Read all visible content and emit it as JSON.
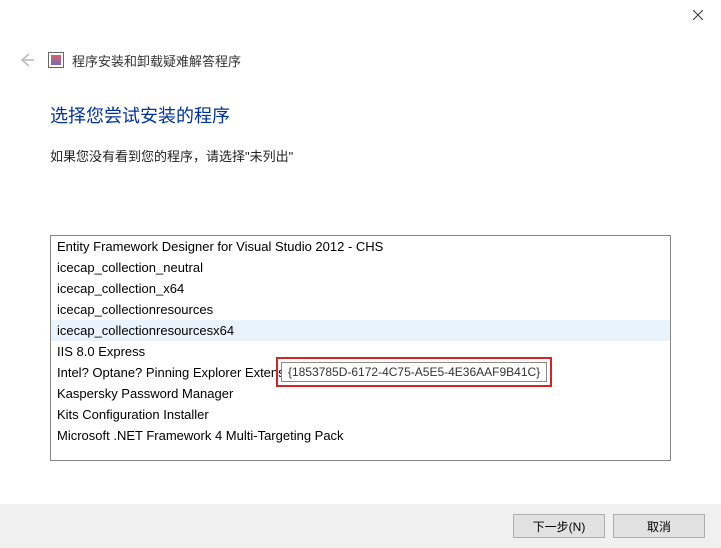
{
  "titlebar": {
    "close_label": "Close"
  },
  "header": {
    "back_label": "Back",
    "title": "程序安装和卸载疑难解答程序"
  },
  "content": {
    "heading": "选择您尝试安装的程序",
    "instruction": "如果您没有看到您的程序，请选择\"未列出\""
  },
  "programs": [
    "Entity Framework Designer for Visual Studio 2012 - CHS",
    "icecap_collection_neutral",
    "icecap_collection_x64",
    "icecap_collectionresources",
    "icecap_collectionresourcesx64",
    "IIS 8.0 Express",
    "Intel? Optane? Pinning Explorer Extensions",
    "Kaspersky Password Manager",
    "Kits Configuration Installer",
    "Microsoft .NET Framework 4 Multi-Targeting Pack"
  ],
  "hover_index": 4,
  "tooltip": {
    "text": "{1853785D-6172-4C75-A5E5-4E36AAF9B41C}"
  },
  "footer": {
    "next": "下一步(N)",
    "cancel": "取消"
  }
}
